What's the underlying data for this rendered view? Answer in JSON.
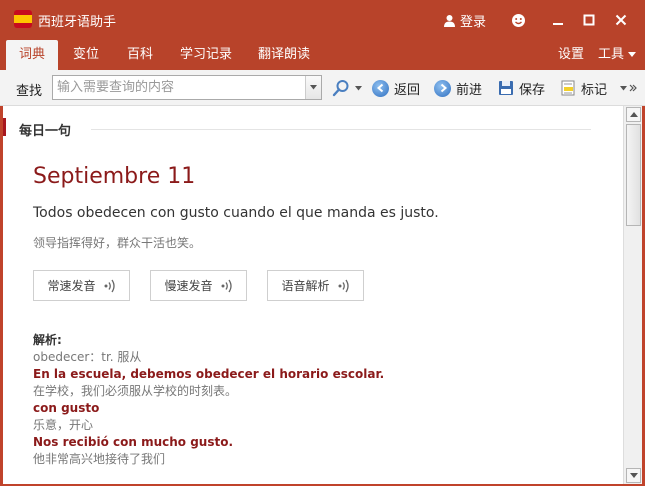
{
  "app": {
    "title": "西班牙语助手"
  },
  "titlebar": {
    "login_label": "登录"
  },
  "menu": {
    "tabs": [
      "词典",
      "变位",
      "百科",
      "学习记录",
      "翻译朗读"
    ],
    "settings_label": "设置",
    "tools_label": "工具"
  },
  "toolbar": {
    "search_label": "查找",
    "search_placeholder": "输入需要查询的内容",
    "back_label": "返回",
    "forward_label": "前进",
    "save_label": "保存",
    "mark_label": "标记"
  },
  "daily": {
    "section_title": "每日一句",
    "date": "Septiembre 11",
    "sentence": "Todos obedecen con gusto cuando el que manda es justo.",
    "translation": "领导指挥得好，群众干活也笑。",
    "audio_buttons": [
      "常速发音",
      "慢速发音",
      "语音解析"
    ],
    "analysis": {
      "heading": "解析:",
      "lines": [
        {
          "text": "obedecer：tr. 服从",
          "style": "gray"
        },
        {
          "text": "En la escuela, debemos obedecer el horario escolar.",
          "style": "red"
        },
        {
          "text": "在学校，我们必须服从学校的时刻表。",
          "style": "gray"
        },
        {
          "text": "con gusto",
          "style": "red"
        },
        {
          "text": "乐意，开心",
          "style": "gray"
        },
        {
          "text": "Nos recibió con mucho gusto.",
          "style": "red"
        },
        {
          "text": "他非常高兴地接待了我们",
          "style": "gray"
        }
      ]
    }
  },
  "colors": {
    "brand": "#b8432a",
    "accent_red": "#8b1a1a"
  },
  "icons": [
    "spain-flag-icon",
    "user-icon",
    "smiley-icon",
    "minimize-icon",
    "maximize-icon",
    "close-icon",
    "search-icon",
    "back-icon",
    "forward-icon",
    "save-icon",
    "mark-icon",
    "sound-icon"
  ]
}
